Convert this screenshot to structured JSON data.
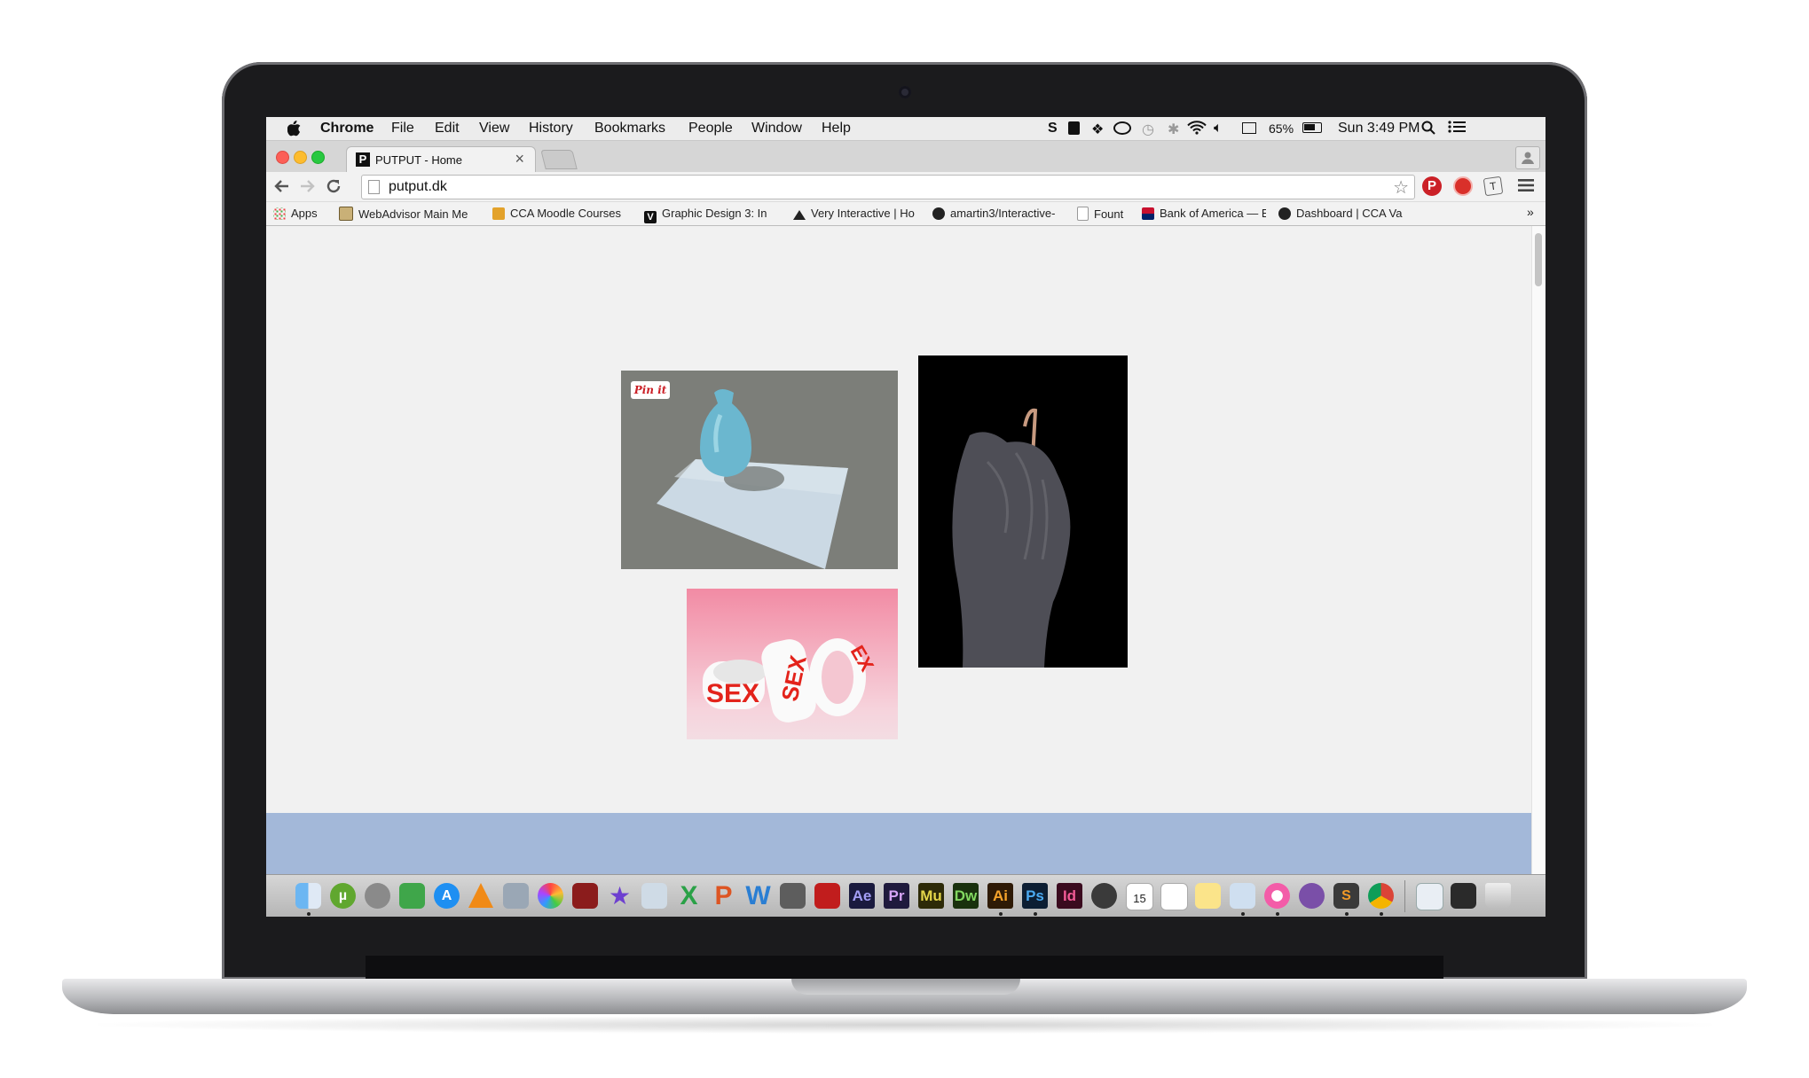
{
  "menubar": {
    "apple": "",
    "app": "Chrome",
    "menus": [
      "File",
      "Edit",
      "View",
      "History",
      "Bookmarks",
      "People",
      "Window",
      "Help"
    ],
    "battery": "65%",
    "clock": "Sun 3:49 PM"
  },
  "tab": {
    "title": "PUTPUT - Home",
    "favicon": "P",
    "close": "×"
  },
  "omnibox": {
    "url": "putput.dk"
  },
  "bookmarks": [
    {
      "label": "Apps"
    },
    {
      "label": "WebAdvisor Main Me"
    },
    {
      "label": "CCA Moodle Courses"
    },
    {
      "label": "Graphic Design 3: In"
    },
    {
      "label": "Very Interactive | Ho"
    },
    {
      "label": "amartin3/Interactive-"
    },
    {
      "label": "Fount"
    },
    {
      "label": "Bank of America — E"
    },
    {
      "label": "Dashboard | CCA Va"
    }
  ],
  "bookmarks_more": "»",
  "page": {
    "pin_label": "Pin it",
    "images": [
      "vase-on-paper-photo",
      "draped-garment-photo",
      "sex-tape-rolls-photo"
    ],
    "tape_text": "SEX"
  },
  "dock": {
    "calendar_day": "15",
    "adobe": [
      "Ae",
      "Pr",
      "Mu",
      "Dw",
      "Ai",
      "Ps",
      "Id"
    ]
  }
}
